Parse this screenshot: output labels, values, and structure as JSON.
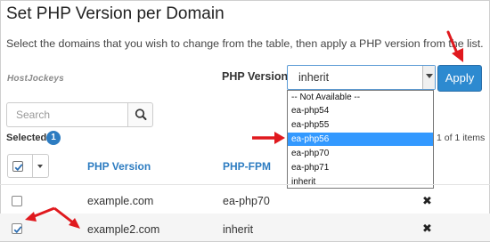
{
  "header": {
    "title": "Set PHP Version per Domain",
    "description": "Select the domains that you wish to change from the table, then apply a PHP version from the list."
  },
  "branding": {
    "watermark": "HostJockeys"
  },
  "php_selector": {
    "label": "PHP Version",
    "selected_value": "inherit",
    "options": [
      "-- Not Available --",
      "ea-php54",
      "ea-php55",
      "ea-php56",
      "ea-php70",
      "ea-php71",
      "inherit"
    ],
    "highlighted_option": "ea-php56",
    "apply_label": "Apply"
  },
  "search": {
    "placeholder": "Search"
  },
  "selection": {
    "label": "Selected",
    "count": "1"
  },
  "pagination": {
    "text": "1 of 1 items"
  },
  "table": {
    "columns": [
      "PHP Version",
      "PHP-FPM"
    ],
    "rows": [
      {
        "domain": "example.com",
        "php_version": "ea-php70",
        "checked": false
      },
      {
        "domain": "example2.com",
        "php_version": "inherit",
        "checked": true
      }
    ]
  },
  "colors": {
    "accent": "#2d8ad0",
    "annotation_arrow": "#e0191e",
    "highlight": "#3399ff"
  }
}
